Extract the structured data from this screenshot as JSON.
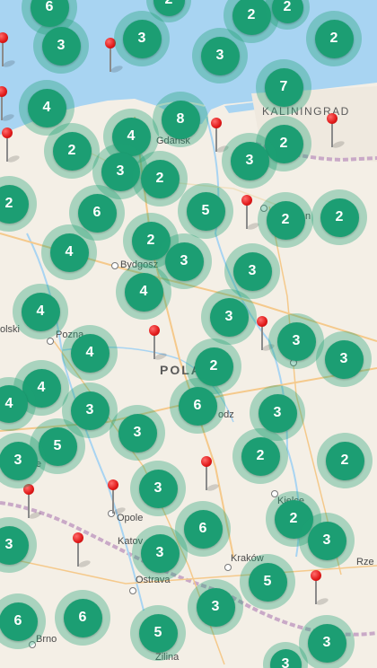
{
  "map": {
    "colors": {
      "land": "#f4efe6",
      "water": "#a8d4f2",
      "cluster": "#1c9e73",
      "pin": "#e01818"
    },
    "labels": {
      "kaliningrad": "KALININGRAD",
      "gdansk": "Gdańsk",
      "bydgoszcz": "Bydgosz",
      "poznan": "Pozna",
      "olski": "olski",
      "poland": "POLAND",
      "lodz": "odz",
      "kielce": "Kielce",
      "opole": "Opole",
      "katowice": "Katov",
      "krakow": "Kraków",
      "rzeszow": "Rze",
      "ostrava": "Ostrava",
      "brno": "Brno",
      "zilina": "Žilina",
      "town_a": "n",
      "town_b": "e"
    },
    "clusters": [
      "6",
      "2",
      "3",
      "3",
      "2",
      "2",
      "2",
      "3",
      "4",
      "7",
      "8",
      "4",
      "2",
      "2",
      "3",
      "2",
      "3",
      "2",
      "6",
      "5",
      "2",
      "2",
      "4",
      "2",
      "3",
      "4",
      "3",
      "4",
      "3",
      "4",
      "3",
      "2",
      "3",
      "4",
      "4",
      "6",
      "3",
      "3",
      "3",
      "5",
      "3",
      "2",
      "2",
      "3",
      "6",
      "2",
      "3",
      "3",
      "3",
      "5",
      "6",
      "6",
      "5",
      "3",
      "3",
      "3"
    ],
    "pin_count": 12
  }
}
